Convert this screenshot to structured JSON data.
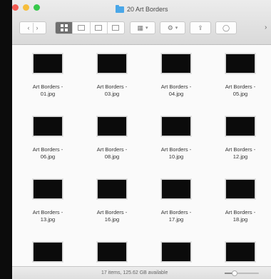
{
  "window": {
    "title": "20 Art Borders",
    "title_icon": "folder-icon"
  },
  "toolbar": {
    "back_icon": "chevron-left-icon",
    "forward_icon": "chevron-right-icon",
    "view_modes": [
      "icon-view",
      "list-view",
      "column-view",
      "gallery-view"
    ],
    "active_view": "icon-view",
    "arrange_icon": "arrange-grid-icon",
    "action_icon": "gear-icon",
    "share_icon": "share-icon",
    "tag_icon": "tag-icon",
    "more_glyph": "›"
  },
  "files": [
    {
      "name": "Art Borders -\n01.jpg"
    },
    {
      "name": "Art Borders -\n03.jpg"
    },
    {
      "name": "Art Borders -\n04.jpg"
    },
    {
      "name": "Art Borders -\n05.jpg"
    },
    {
      "name": "Art Borders -\n06.jpg"
    },
    {
      "name": "Art Borders -\n08.jpg"
    },
    {
      "name": "Art Borders -\n10.jpg"
    },
    {
      "name": "Art Borders -\n12.jpg"
    },
    {
      "name": "Art Borders -\n13.jpg"
    },
    {
      "name": "Art Borders -\n16.jpg"
    },
    {
      "name": "Art Borders -\n17.jpg"
    },
    {
      "name": "Art Borders -\n18.jpg"
    },
    {
      "name": ""
    },
    {
      "name": ""
    },
    {
      "name": ""
    },
    {
      "name": ""
    }
  ],
  "status": {
    "text": "17 items, 125.62 GB available",
    "zoom_level": 0.3
  },
  "colors": {
    "folder_accent": "#4aa7e8",
    "close": "#f25b52",
    "minimize": "#f6bd3b",
    "zoom": "#36c84b"
  }
}
